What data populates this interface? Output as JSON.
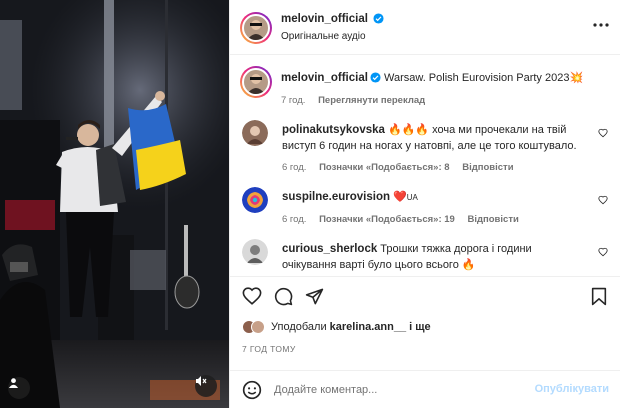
{
  "colors": {
    "accent": "#0095f6",
    "verified": "#0095f6",
    "publish_disabled": "#b3dbff",
    "muted_text": "#737373"
  },
  "header": {
    "username": "melovin_official",
    "audio": "Оригінальне аудіо",
    "more_icon": "more-horizontal-icon"
  },
  "caption": {
    "username": "melovin_official",
    "text": "Warsaw. Polish Eurovision Party 2023",
    "emoji": "💥",
    "time": "7 год.",
    "translate": "Переглянути переклад"
  },
  "comments": [
    {
      "username": "polinakutsykovska",
      "emoji": "🔥🔥🔥",
      "text": "хоча ми прочекали на твій виступ 6 годин на ногах у натовпі, але це того коштувало.",
      "time": "6 год.",
      "likes": "Позначки «Подобається»: 8",
      "reply": "Відповісти"
    },
    {
      "username": "suspilne.eurovision",
      "emoji": "❤️",
      "text": "UA",
      "time": "6 год.",
      "likes": "Позначки «Подобається»: 19",
      "reply": "Відповісти"
    },
    {
      "username": "curious_sherlock",
      "text": "Трошки тяжка дорога і години очікування варті було цього всього",
      "emoji": "🔥"
    }
  ],
  "likes": {
    "prefix": "Уподобали",
    "user": "karelina.ann__",
    "suffix": "і ще"
  },
  "post_time": "7 ГОД ТОМУ",
  "composer": {
    "placeholder": "Додайте коментар...",
    "publish": "Опублікувати",
    "emoji_icon": "smiley-icon"
  }
}
